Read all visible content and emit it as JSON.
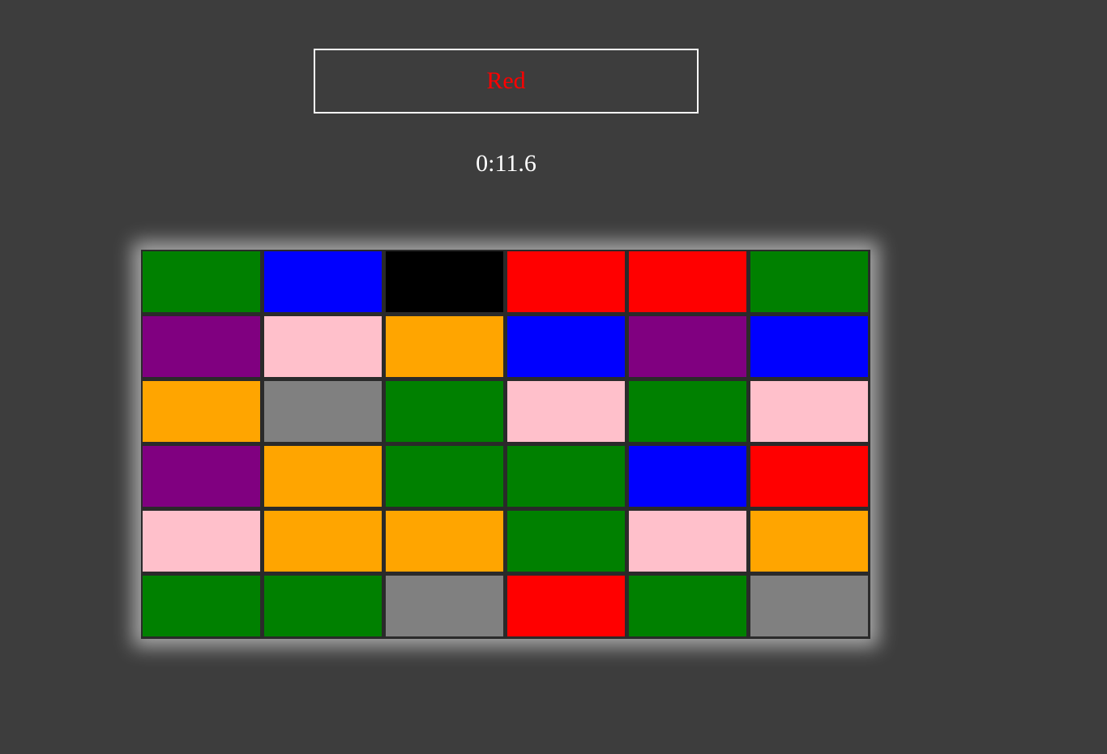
{
  "prompt": {
    "word": "Red",
    "word_color": "#ff0000"
  },
  "timer": {
    "text": "0:11.6"
  },
  "board": {
    "rows": [
      [
        "#008000",
        "#0000ff",
        "#000000",
        "#ff0000",
        "#ff0000",
        "#008000"
      ],
      [
        "#800080",
        "#ffc0cb",
        "#ffa500",
        "#0000ff",
        "#800080",
        "#0000ff"
      ],
      [
        "#ffa500",
        "#808080",
        "#008000",
        "#ffc0cb",
        "#008000",
        "#ffc0cb"
      ],
      [
        "#800080",
        "#ffa500",
        "#008000",
        "#008000",
        "#0000ff",
        "#ff0000"
      ],
      [
        "#ffc0cb",
        "#ffa500",
        "#ffa500",
        "#008000",
        "#ffc0cb",
        "#ffa500"
      ],
      [
        "#008000",
        "#008000",
        "#808080",
        "#ff0000",
        "#008000",
        "#808080"
      ]
    ]
  }
}
